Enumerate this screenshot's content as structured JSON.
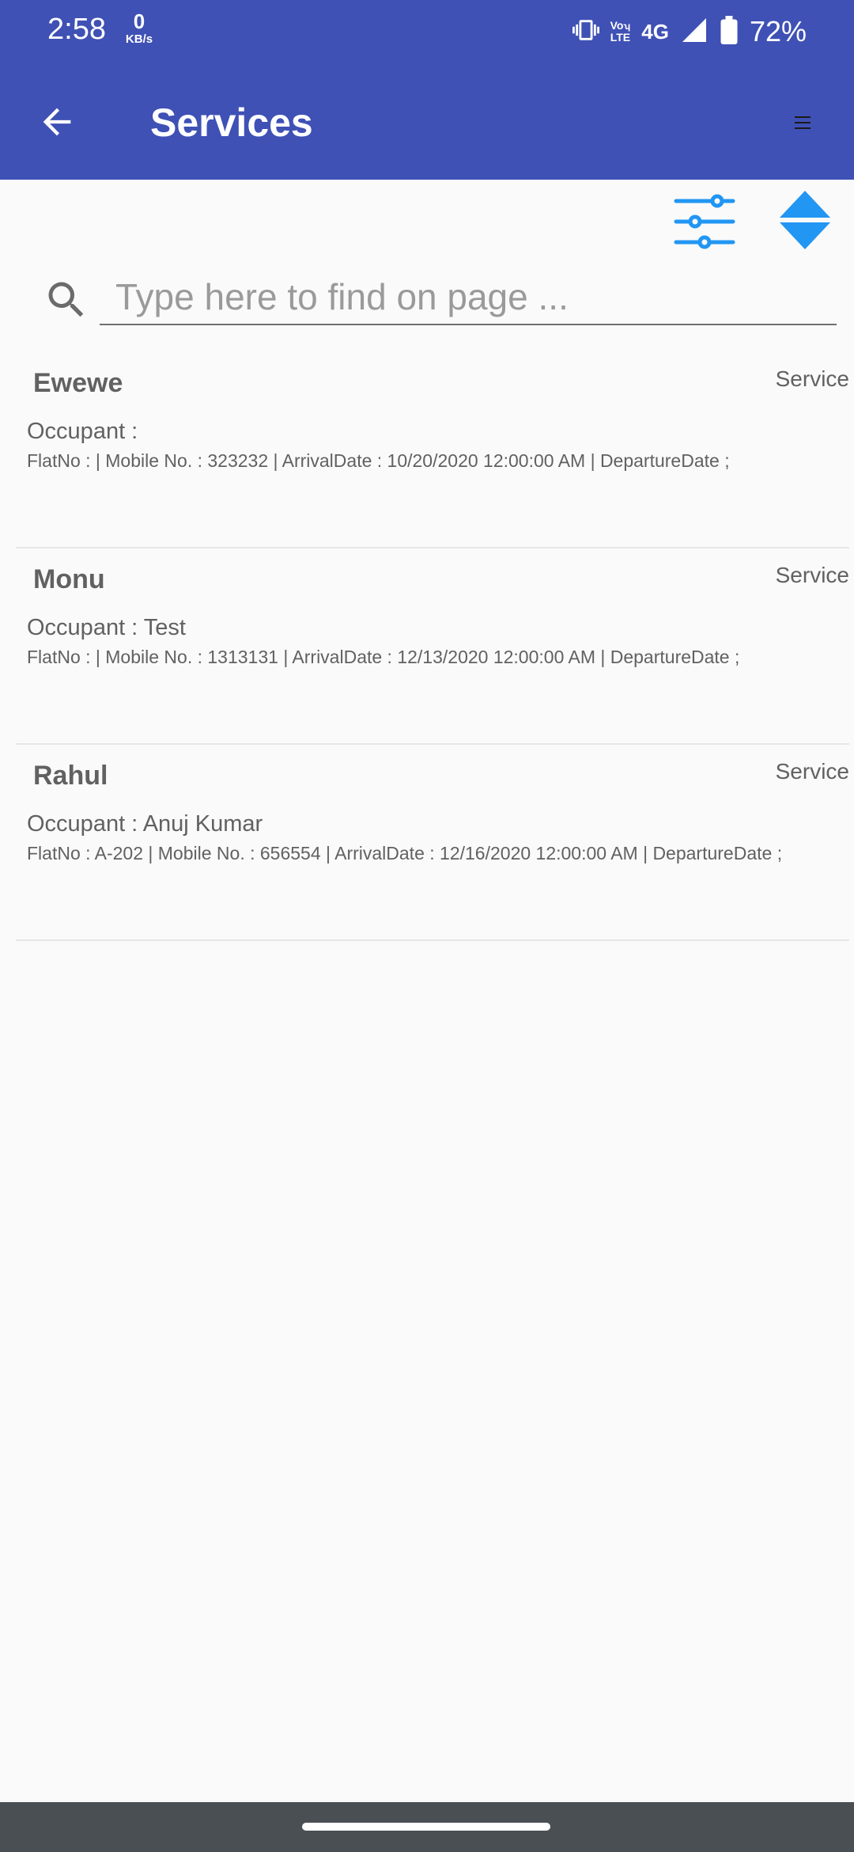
{
  "status_bar": {
    "time": "2:58",
    "speed_value": "0",
    "speed_unit": "KB/s",
    "volte_top": "Vo",
    "volte_bottom": "LTE",
    "network": "4G",
    "battery": "72%"
  },
  "app_bar": {
    "title": "Services",
    "back_icon": "arrow-left-icon",
    "menu_icon": "hamburger-icon"
  },
  "toolbar": {
    "filter_icon": "sliders-icon",
    "sort_icon": "sort-up-down-icon"
  },
  "search": {
    "placeholder": "Type here to find on page ...",
    "value": ""
  },
  "services": [
    {
      "name": "Ewewe",
      "type": "Service",
      "occupant": "Occupant : ",
      "details": "FlatNo :  | Mobile No. : 323232 | ArrivalDate : 10/20/2020 12:00:00 AM | DepartureDate ;"
    },
    {
      "name": "Monu",
      "type": "Service",
      "occupant": "Occupant : Test",
      "details": "FlatNo :  | Mobile No. : 1313131 | ArrivalDate : 12/13/2020 12:00:00 AM | DepartureDate ;"
    },
    {
      "name": "Rahul",
      "type": "Service",
      "occupant": "Occupant : Anuj Kumar",
      "details": "FlatNo : A-202 | Mobile No. : 656554 | ArrivalDate : 12/16/2020 12:00:00 AM | DepartureDate ;"
    }
  ],
  "colors": {
    "primary": "#3f51b5",
    "accent": "#2196f3",
    "text": "#616161",
    "background": "#fafafa",
    "nav_bar": "#4a4f54"
  }
}
